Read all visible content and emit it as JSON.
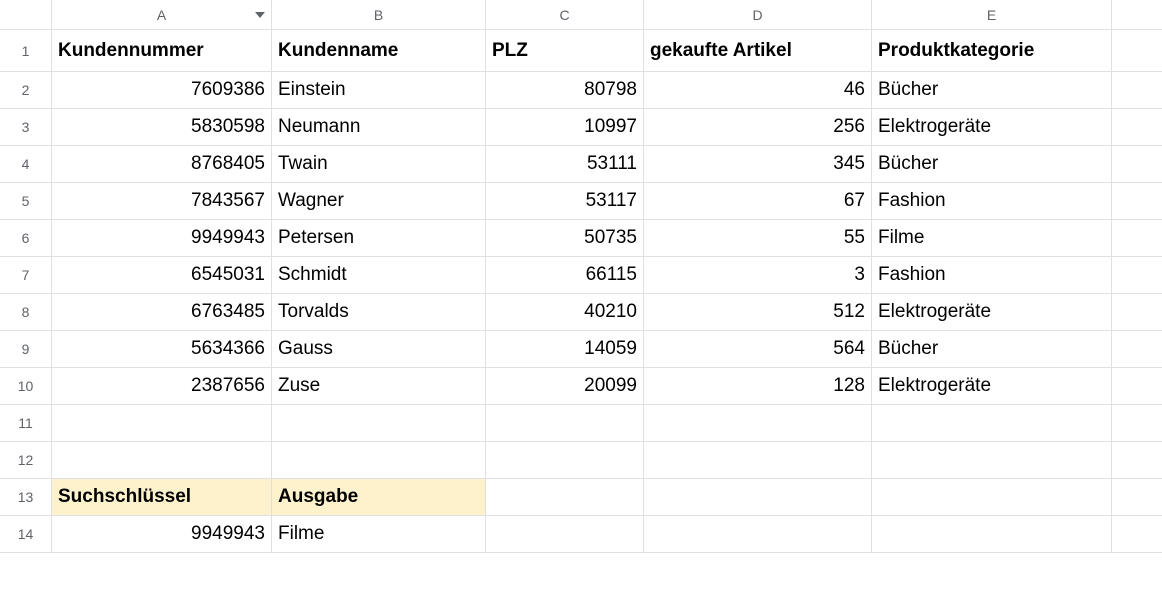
{
  "columns": [
    "A",
    "B",
    "C",
    "D",
    "E"
  ],
  "filterColumn": "A",
  "rowNumbers": [
    1,
    2,
    3,
    4,
    5,
    6,
    7,
    8,
    9,
    10,
    11,
    12,
    13,
    14
  ],
  "headerRow": [
    "Kundennummer",
    "Kundenname",
    "PLZ",
    "gekaufte Artikel",
    "Produktkategorie"
  ],
  "dataRows": [
    {
      "num": "7609386",
      "name": "Einstein",
      "plz": "80798",
      "art": "46",
      "cat": "Bücher"
    },
    {
      "num": "5830598",
      "name": "Neumann",
      "plz": "10997",
      "art": "256",
      "cat": "Elektrogeräte"
    },
    {
      "num": "8768405",
      "name": "Twain",
      "plz": "53111",
      "art": "345",
      "cat": "Bücher"
    },
    {
      "num": "7843567",
      "name": "Wagner",
      "plz": "53117",
      "art": "67",
      "cat": "Fashion"
    },
    {
      "num": "9949943",
      "name": "Petersen",
      "plz": "50735",
      "art": "55",
      "cat": "Filme"
    },
    {
      "num": "6545031",
      "name": "Schmidt",
      "plz": "66115",
      "art": "3",
      "cat": "Fashion"
    },
    {
      "num": "6763485",
      "name": "Torvalds",
      "plz": "40210",
      "art": "512",
      "cat": "Elektrogeräte"
    },
    {
      "num": "5634366",
      "name": "Gauss",
      "plz": "14059",
      "art": "564",
      "cat": "Bücher"
    },
    {
      "num": "2387656",
      "name": "Zuse",
      "plz": "20099",
      "art": "128",
      "cat": "Elektrogeräte"
    }
  ],
  "lookup": {
    "keyLabel": "Suchschlüssel",
    "outLabel": "Ausgabe",
    "keyValue": "9949943",
    "outValue": "Filme"
  }
}
